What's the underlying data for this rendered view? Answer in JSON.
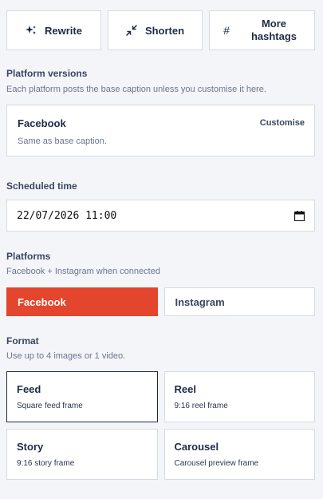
{
  "actions": {
    "rewrite_label": "Rewrite",
    "shorten_label": "Shorten",
    "more_hashtags_line1": "More",
    "more_hashtags_line2": "hashtags",
    "hashtag_icon": "#"
  },
  "platform_versions": {
    "title": "Platform versions",
    "help": "Each platform posts the base caption unless you customise it here.",
    "card": {
      "name": "Facebook",
      "subtitle": "Same as base caption.",
      "action": "Customise"
    }
  },
  "scheduled_time": {
    "title": "Scheduled time",
    "value": "22/07/2026 11:00"
  },
  "platforms": {
    "title": "Platforms",
    "help": "Facebook + Instagram when connected",
    "options": [
      {
        "label": "Facebook",
        "active": true
      },
      {
        "label": "Instagram",
        "active": false
      }
    ]
  },
  "format": {
    "title": "Format",
    "help": "Use up to 4 images or 1 video.",
    "options": [
      {
        "title": "Feed",
        "subtitle": "Square feed frame",
        "selected": true
      },
      {
        "title": "Reel",
        "subtitle": "9:16 reel frame",
        "selected": false
      },
      {
        "title": "Story",
        "subtitle": "9:16 story frame",
        "selected": false
      },
      {
        "title": "Carousel",
        "subtitle": "Carousel preview frame",
        "selected": false
      }
    ]
  },
  "colors": {
    "accent": "#e4452d",
    "text": "#1f2a44",
    "border": "#d5d9e2",
    "background": "#f4f5f9"
  },
  "icons": {
    "rewrite": "sparkles-icon",
    "shorten": "shrink-arrows-icon",
    "hashtags": "hashtag-icon",
    "calendar": "calendar-icon"
  }
}
